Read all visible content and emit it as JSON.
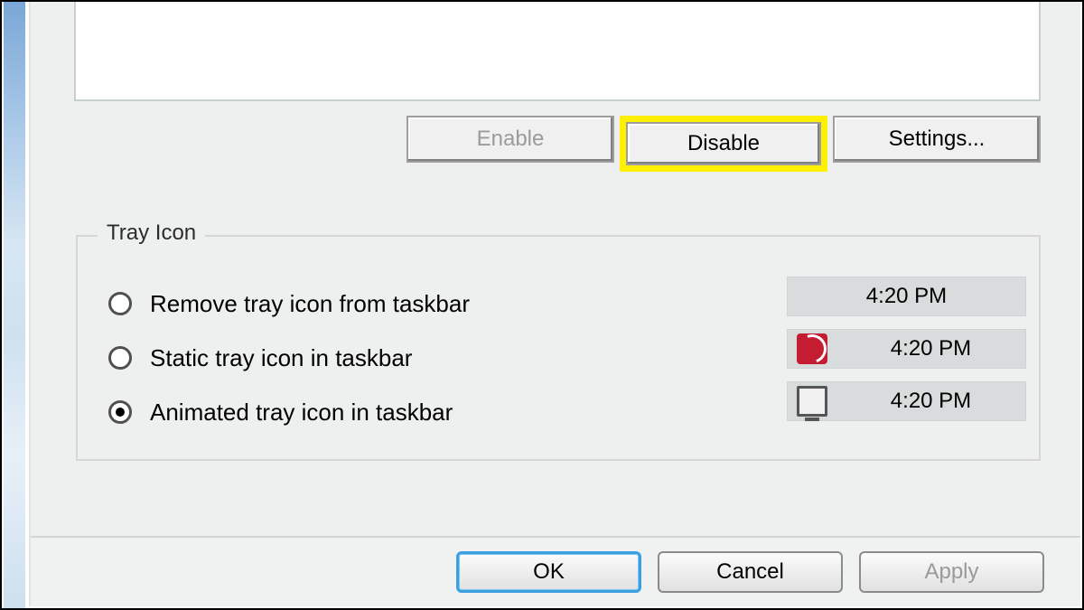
{
  "actions": {
    "enable": "Enable",
    "disable": "Disable",
    "settings": "Settings..."
  },
  "tray_group": {
    "legend": "Tray Icon",
    "options": [
      {
        "label": "Remove tray icon from taskbar",
        "selected": false,
        "preview_time": "4:20 PM",
        "icon": "none"
      },
      {
        "label": "Static tray icon in taskbar",
        "selected": false,
        "preview_time": "4:20 PM",
        "icon": "red-logo"
      },
      {
        "label": "Animated tray icon in taskbar",
        "selected": true,
        "preview_time": "4:20 PM",
        "icon": "monitor"
      }
    ]
  },
  "dialog_buttons": {
    "ok": "OK",
    "cancel": "Cancel",
    "apply": "Apply"
  },
  "highlight": "disable"
}
